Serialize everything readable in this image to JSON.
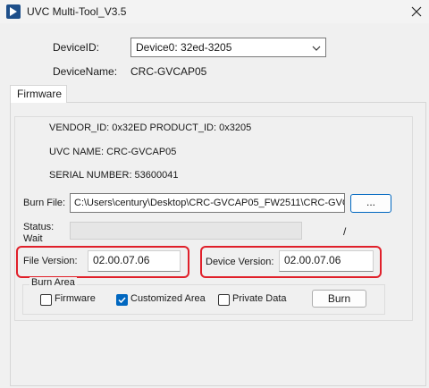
{
  "window": {
    "title": "UVC Multi-Tool_V3.5"
  },
  "device": {
    "id_label": "DeviceID:",
    "id_value": "Device0:  32ed-3205",
    "name_label": "DeviceName:",
    "name_value": "CRC-GVCAP05"
  },
  "tabs": [
    {
      "label": "Firmware"
    }
  ],
  "firmware": {
    "vendor_product": "VENDOR_ID:  0x32ED   PRODUCT_ID:  0x3205",
    "uvc_name": "UVC NAME:   CRC-GVCAP05",
    "serial": "SERIAL NUMBER:   53600041",
    "burn_file_label": "Burn File:",
    "burn_file_value": "C:\\Users\\century\\Desktop\\CRC-GVCAP05_FW2511\\CRC-GVCAP05",
    "browse_label": "...",
    "status_label_line1": "Status:",
    "status_label_line2": "Wait",
    "status_slash": "/",
    "file_version_label": "File Version:",
    "file_version_value": "02.00.07.06",
    "device_version_label": "Device Version:",
    "device_version_value": "02.00.07.06"
  },
  "burn_area": {
    "title": "Burn Area",
    "options": [
      {
        "label": "Firmware",
        "checked": false
      },
      {
        "label": "Customized Area",
        "checked": true
      },
      {
        "label": "Private Data",
        "checked": false
      }
    ],
    "burn_button": "Burn"
  },
  "colors": {
    "highlight_frame": "#e0202a",
    "accent": "#0067c0"
  }
}
